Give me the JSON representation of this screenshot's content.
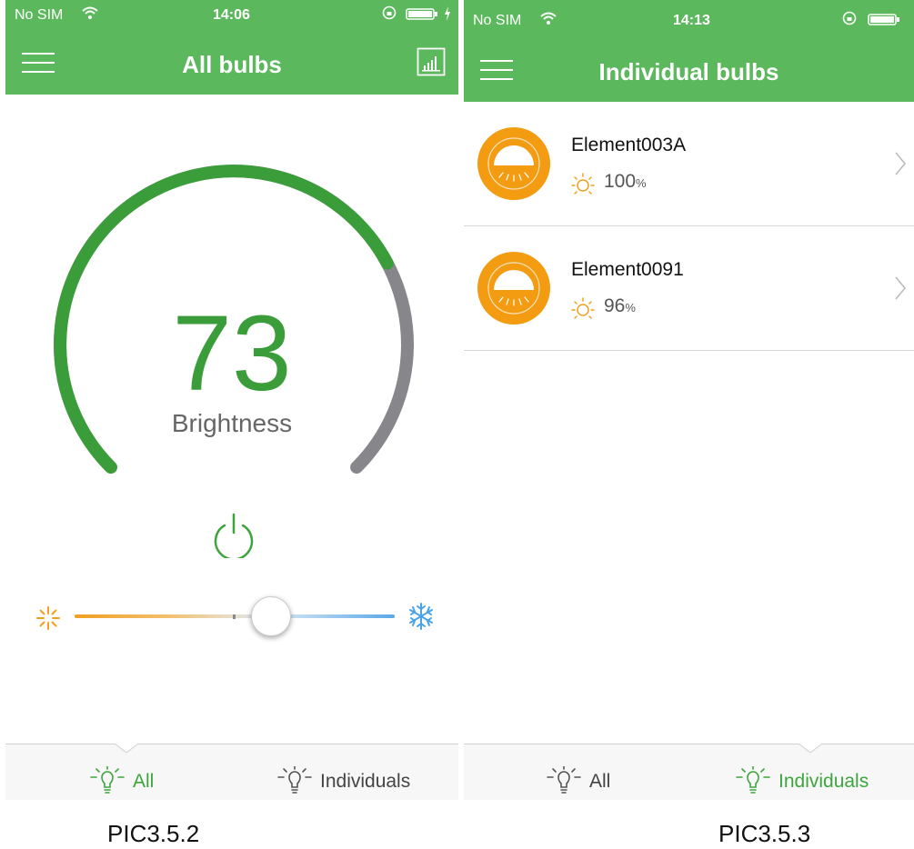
{
  "colors": {
    "header_green": "#5cb85c",
    "ring_green": "#3a9d3a",
    "ring_gray": "#86868b",
    "bulb_orange": "#f39c12",
    "tab_active": "#3ea53e"
  },
  "left": {
    "status": {
      "carrier": "No SIM",
      "time": "14:06"
    },
    "header": {
      "title": "All bulbs",
      "menu_icon": "hamburger-icon",
      "stats_icon": "bar-chart-icon"
    },
    "brightness": {
      "value": 73,
      "label": "Brightness"
    },
    "color_temperature": {
      "level_percent": 61,
      "warm_icon": "sun-icon",
      "cool_icon": "snowflake-icon"
    },
    "tabs": [
      {
        "label": "All",
        "active": true,
        "icon": "bulb-icon"
      },
      {
        "label": "Individuals",
        "active": false,
        "icon": "bulb-icon"
      }
    ]
  },
  "right": {
    "status": {
      "carrier": "No SIM",
      "time": "14:13"
    },
    "header": {
      "title": "Individual bulbs",
      "menu_icon": "hamburger-icon"
    },
    "bulbs": [
      {
        "name": "Element003A",
        "level": "100",
        "unit": "%"
      },
      {
        "name": "Element0091",
        "level": "96",
        "unit": "%"
      }
    ],
    "tabs": [
      {
        "label": "All",
        "active": false,
        "icon": "bulb-icon"
      },
      {
        "label": "Individuals",
        "active": true,
        "icon": "bulb-icon"
      }
    ]
  },
  "captions": {
    "left": "PIC3.5.2",
    "right": "PIC3.5.3"
  }
}
